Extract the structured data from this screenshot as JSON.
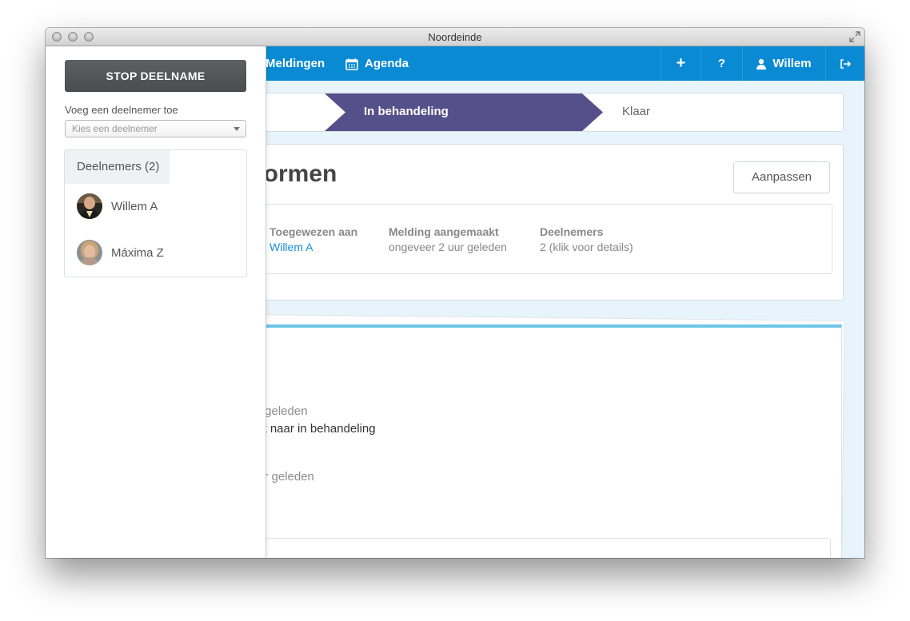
{
  "window": {
    "title": "Noordeinde"
  },
  "nav": {
    "meldingen": "Meldingen",
    "agenda": "Agenda",
    "plus": "+",
    "help": "?",
    "user": "Willem"
  },
  "steps": {
    "active": "In behandeling",
    "done": "Klaar"
  },
  "card": {
    "title": "vormen",
    "edit_button": "Aanpassen",
    "meta": [
      {
        "label": "Toegewezen aan",
        "value": "Willem A"
      },
      {
        "label": "Melding aangemaakt",
        "value": "ongeveer 2 uur geleden"
      },
      {
        "label": "Deelnemers",
        "value": "2 (klik voor details)"
      }
    ]
  },
  "feed": {
    "time1": "r geleden",
    "text1": "st naar in behandeling",
    "time2": "ur geleden"
  },
  "sidebar": {
    "stop_button": "STOP DEELNAME",
    "add_label": "Voeg een deelnemer toe",
    "select_placeholder": "Kies een deelnemer",
    "participants_tab": "Deelnemers (2)",
    "participants": [
      {
        "name": "Willem A",
        "avatar_icon": "person-photo"
      },
      {
        "name": "Máxima Z",
        "avatar_icon": "person-photo"
      }
    ]
  },
  "colors": {
    "nav_blue": "#0a8ad2",
    "step_purple": "#56508a",
    "link_blue": "#1a8fd6",
    "stop_button": "#505254"
  }
}
